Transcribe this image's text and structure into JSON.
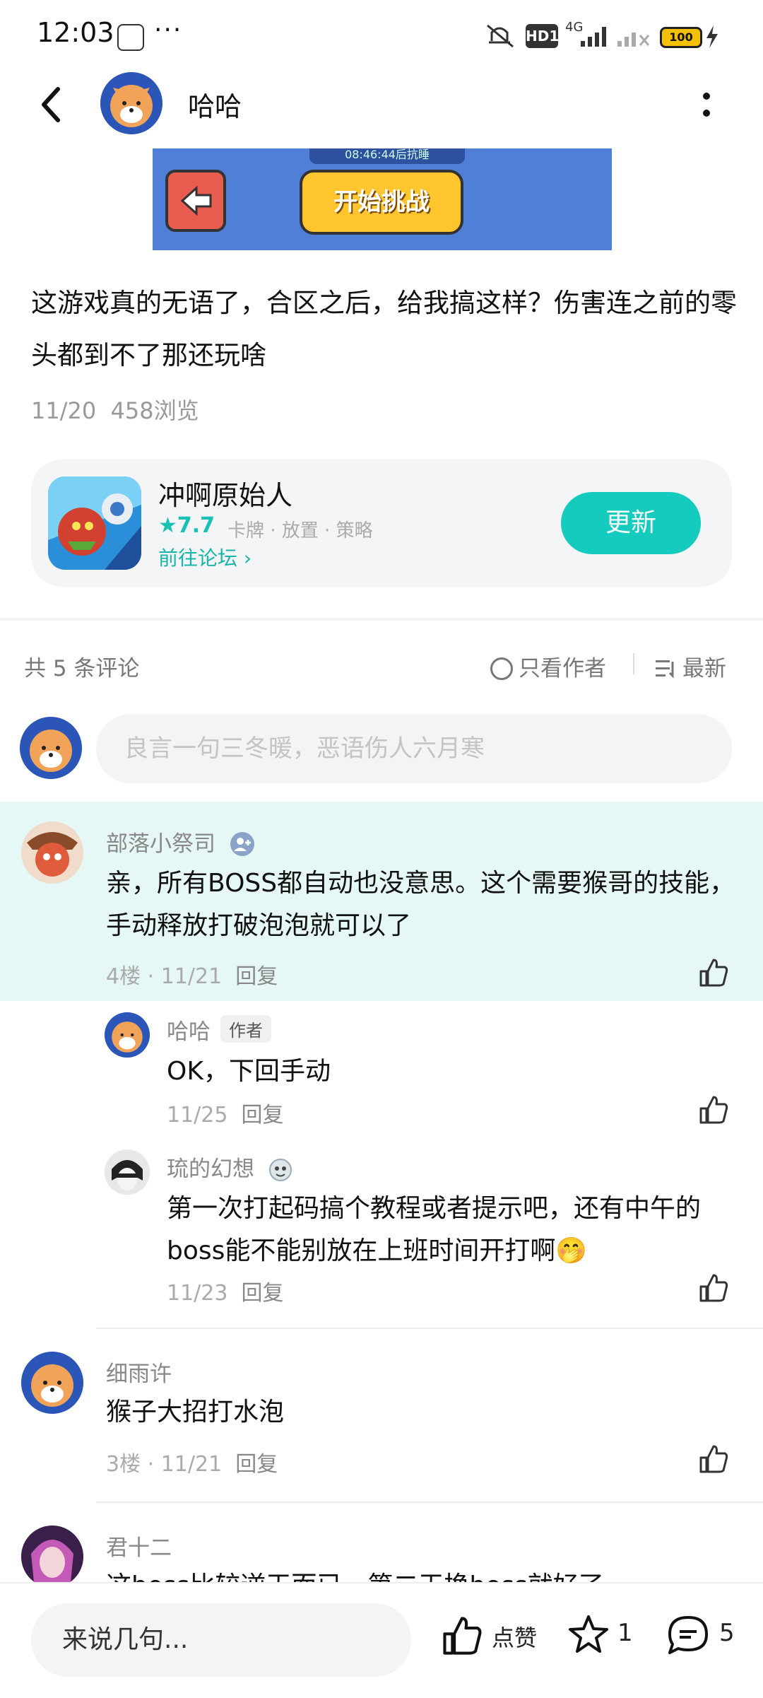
{
  "status_bar": {
    "time": "12:03",
    "more": "···",
    "network": "HD1",
    "net_type": "4G",
    "battery": "100"
  },
  "header": {
    "title": "哈哈"
  },
  "game_banner": {
    "countdown": "08:46:44后抗睡",
    "start_label": "开始挑战"
  },
  "post": {
    "text": "这游戏真的无语了，合区之后，给我搞这样？伤害连之前的零头都到不了那还玩啥",
    "date": "11/20",
    "views": "458浏览"
  },
  "game_card": {
    "name": "冲啊原始人",
    "rating": "★7.7",
    "tags": "卡牌 · 放置 · 策略",
    "forum_link": "前往论坛 ›",
    "update_label": "更新"
  },
  "comments_header": {
    "count": "共 5 条评论",
    "only_author": "只看作者",
    "sort": "最新"
  },
  "comment_input": {
    "placeholder": "良言一句三冬暖，恶语伤人六月寒"
  },
  "comments": [
    {
      "name": "部落小祭司",
      "text": "亲，所有BOSS都自动也没意思。这个需要猴哥的技能，手动释放打破泡泡就可以了",
      "floor": "4楼 · 11/21",
      "reply": "回复",
      "replies": [
        {
          "name": "哈哈",
          "tag": "作者",
          "text": "OK，下回手动",
          "date": "11/25",
          "reply": "回复"
        },
        {
          "name": "琉的幻想",
          "text": "第一次打起码搞个教程或者提示吧，还有中午的boss能不能别放在上班时间开打啊🤭",
          "date": "11/23",
          "reply": "回复"
        }
      ]
    },
    {
      "name": "细雨许",
      "text": "猴子大招打水泡",
      "floor": "3楼 · 11/21",
      "reply": "回复"
    },
    {
      "name": "君十二",
      "text": "这boss比较逆天而已，第二天换boss就好了"
    }
  ],
  "bottom_bar": {
    "input_placeholder": "来说几句...",
    "like_label": "点赞",
    "star_count": "1",
    "comment_count": "5"
  },
  "colors": {
    "accent": "#15cbbd",
    "highlight_bg": "#e6f8f6"
  }
}
